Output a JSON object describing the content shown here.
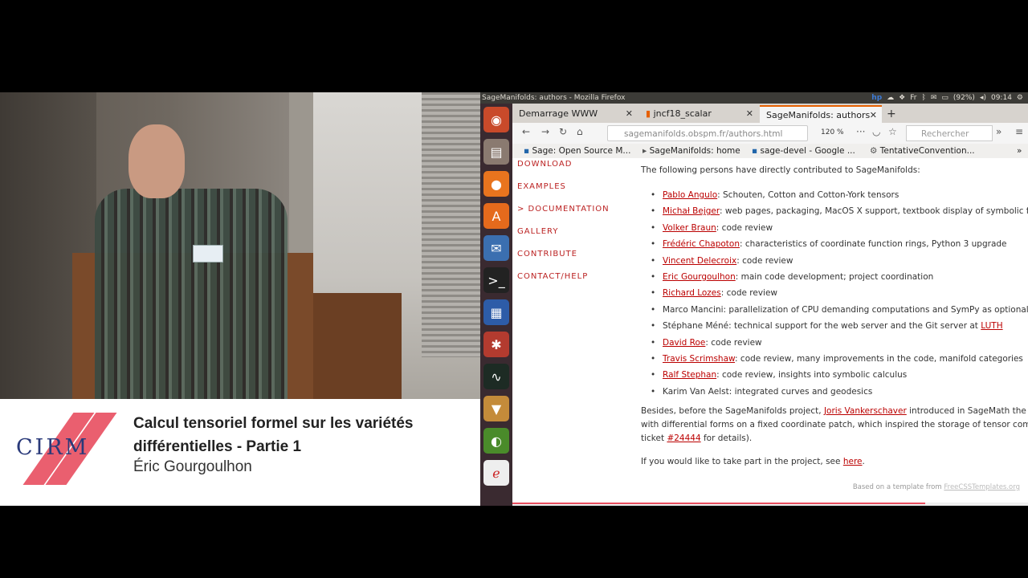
{
  "caption": {
    "logo_text": "CIRM",
    "title_line1": "Calcul tensoriel formel sur les variétés",
    "title_line2": "différentielles - Partie 1",
    "speaker": "Éric Gourgoulhon"
  },
  "os": {
    "window_title": "SageManifolds: authors - Mozilla Firefox",
    "battery": "(92%)",
    "clock": "09:14",
    "lang": "Fr"
  },
  "browser": {
    "tabs": [
      {
        "label": "Demarrage WWW",
        "active": false
      },
      {
        "label": "jncf18_scalar",
        "active": false
      },
      {
        "label": "SageManifolds: authors",
        "active": true
      }
    ],
    "url": "sagemanifolds.obspm.fr/authors.html",
    "zoom": "120 %",
    "search_placeholder": "Rechercher",
    "bookmarks": [
      "Sage: Open Source M...",
      "SageManifolds: home",
      "sage-devel - Google ...",
      "TentativeConvention..."
    ]
  },
  "site_nav": [
    "DOWNLOAD",
    "EXAMPLES",
    "> DOCUMENTATION",
    "GALLERY",
    "CONTRIBUTE",
    "CONTACT/HELP"
  ],
  "page": {
    "intro": "The following persons have directly contributed to SageManifolds:",
    "contributors": [
      {
        "name": "Pablo Angulo",
        "linked": true,
        "text": ": Schouten, Cotton and Cotton-York tensors"
      },
      {
        "name": "Michał Bejger",
        "linked": true,
        "text": ": web pages, packaging, MacOS X support, textbook display of symbolic fur"
      },
      {
        "name": "Volker Braun",
        "linked": true,
        "text": ": code review"
      },
      {
        "name": "Frédéric Chapoton",
        "linked": true,
        "text": ": characteristics of coordinate function rings, Python 3 upgrade"
      },
      {
        "name": "Vincent Delecroix",
        "linked": true,
        "text": ": code review"
      },
      {
        "name": "Eric Gourgoulhon",
        "linked": true,
        "text": ": main code development; project coordination"
      },
      {
        "name": "Richard Lozes",
        "linked": true,
        "text": ": code review"
      },
      {
        "name": "Marco Mancini",
        "linked": false,
        "text": ": parallelization of CPU demanding computations and SymPy as optional ca"
      },
      {
        "name": "Stéphane Méné",
        "linked": false,
        "text": ": technical support for the web server and the Git server at ",
        "extra_link": "LUTH"
      },
      {
        "name": "David Roe",
        "linked": true,
        "text": ": code review"
      },
      {
        "name": "Travis Scrimshaw",
        "linked": true,
        "text": ": code review, many improvements in the code, manifold categories"
      },
      {
        "name": "Ralf Stephan",
        "linked": true,
        "text": ": code review, insights into symbolic calculus"
      },
      {
        "name": "Karim Van Aelst",
        "linked": false,
        "text": ": integrated curves and geodesics"
      }
    ],
    "besides_pre": "Besides, before the SageManifolds project, ",
    "besides_link": "Joris Vankerschaver",
    "besides_post": " introduced in SageMath the c",
    "besides_line2": "with differential forms on a fixed coordinate patch, which inspired the storage of tensor compo",
    "besides_line3_pre": "ticket ",
    "besides_line3_link": "#24444",
    "besides_line3_post": " for details).",
    "join_pre": "If you would like to take part in the project, see ",
    "join_link": "here",
    "join_post": ".",
    "footer_pre": "Based on a template from ",
    "footer_link": "FreeCSSTemplates.org"
  }
}
